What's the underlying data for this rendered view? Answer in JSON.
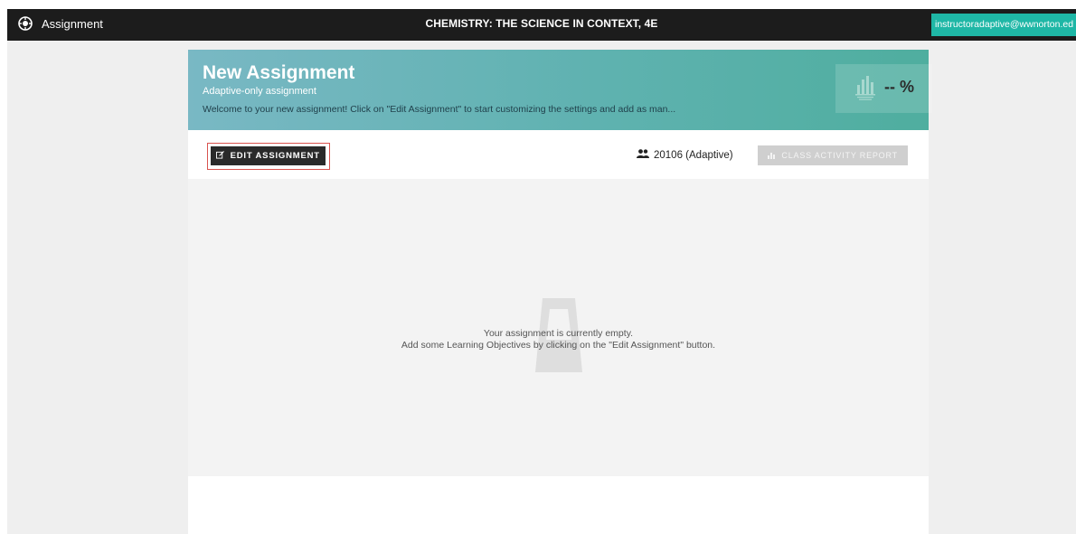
{
  "topbar": {
    "app_icon": "crosshair-circle-icon",
    "app_name": "Assignment",
    "course_title": "CHEMISTRY: THE SCIENCE IN CONTEXT, 4E",
    "user_email": "instructoradaptive@wwnorton.ed"
  },
  "banner": {
    "title": "New Assignment",
    "subtitle": "Adaptive-only assignment",
    "description": "Welcome to your new assignment! Click on \"Edit Assignment\" to start customizing the settings and add as man...",
    "score_icon": "average-score-bar-chart-icon",
    "score_value": "-- %"
  },
  "actions": {
    "edit_label": "EDIT ASSIGNMENT",
    "edit_icon": "edit-icon",
    "class_icon": "people-icon",
    "class_label": "20106 (Adaptive)",
    "report_icon": "bar-chart-icon",
    "report_label": "CLASS ACTIVITY REPORT"
  },
  "empty_state": {
    "line1": "Your assignment is currently empty.",
    "line2": "Add some Learning Objectives by clicking on the \"Edit Assignment\" button."
  },
  "colors": {
    "topbar_bg": "#1c1c1c",
    "user_chip_bg": "#1fb7a6",
    "banner_start": "#79b8c4",
    "banner_end": "#4fae9f",
    "highlight_outline": "#d9534f"
  }
}
